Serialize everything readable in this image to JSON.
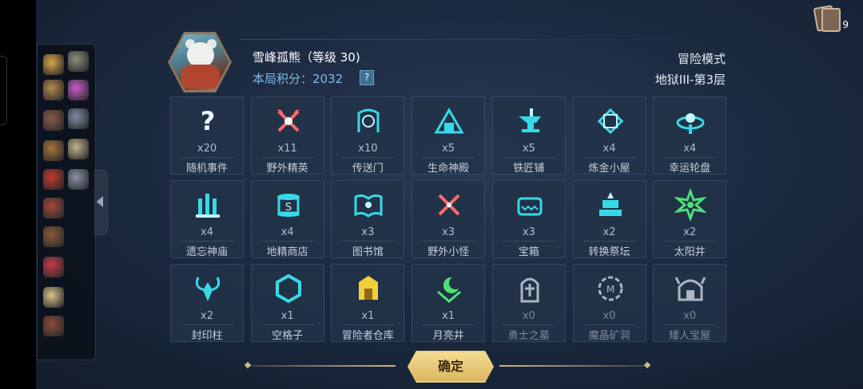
{
  "header": {
    "title": "雪峰孤熊（等级 30)",
    "score_label": "本局积分：",
    "score_value": "2032",
    "help_label": "?",
    "mode": "冒险模式",
    "level": "地狱III-第3层"
  },
  "deck": {
    "count": "9",
    "icon": "card-deck-icon"
  },
  "inventory": {
    "icons": [
      "gold-scroll-icon",
      "statue-icon",
      "chest-plus-icon",
      "planet-icon",
      "stone-icon",
      "card-icon",
      "slingshot-plus-icon",
      "map-plus-icon",
      "bomb-plus-icon",
      "knight-icon",
      "book-plus-icon",
      "tome-plus-icon",
      "claw-plus-icon",
      "scroll-plus-icon",
      "book-tome-icon"
    ]
  },
  "cells": [
    {
      "count": "x20",
      "label": "随机事件",
      "icon": "question-icon",
      "color": "#e9f6ff",
      "dim": false
    },
    {
      "count": "x11",
      "label": "野外精英",
      "icon": "crossed-axes-icon",
      "color": "#ff6a6a",
      "dim": false
    },
    {
      "count": "x10",
      "label": "传送门",
      "icon": "portal-icon",
      "color": "#37d9e8",
      "dim": false
    },
    {
      "count": "x5",
      "label": "生命神殿",
      "icon": "temple-icon",
      "color": "#37d9e8",
      "dim": false
    },
    {
      "count": "x5",
      "label": "铁匠铺",
      "icon": "anvil-icon",
      "color": "#37d9e8",
      "dim": false
    },
    {
      "count": "x4",
      "label": "炼金小屋",
      "icon": "alchemy-icon",
      "color": "#37d9e8",
      "dim": false
    },
    {
      "count": "x4",
      "label": "幸运轮盘",
      "icon": "wheel-icon",
      "color": "#37d9e8",
      "dim": false
    },
    {
      "count": "x4",
      "label": "遗忘神庙",
      "icon": "ruins-icon",
      "color": "#37d9e8",
      "dim": false
    },
    {
      "count": "x4",
      "label": "地精商店",
      "icon": "shop-icon",
      "color": "#37d9e8",
      "dim": false
    },
    {
      "count": "x3",
      "label": "图书馆",
      "icon": "book-icon",
      "color": "#37d9e8",
      "dim": false
    },
    {
      "count": "x3",
      "label": "野外小怪",
      "icon": "crossed-swords-icon",
      "color": "#ff6a6a",
      "dim": false
    },
    {
      "count": "x3",
      "label": "宝箱",
      "icon": "chest-icon",
      "color": "#37d9e8",
      "dim": false
    },
    {
      "count": "x2",
      "label": "转换祭坛",
      "icon": "altar-icon",
      "color": "#37d9e8",
      "dim": false
    },
    {
      "count": "x2",
      "label": "太阳井",
      "icon": "sun-icon",
      "color": "#4fe07a",
      "dim": false
    },
    {
      "count": "x2",
      "label": "封印柱",
      "icon": "seal-pillar-icon",
      "color": "#37d9e8",
      "dim": false
    },
    {
      "count": "x1",
      "label": "空格子",
      "icon": "hexagon-icon",
      "color": "#37d9e8",
      "dim": false
    },
    {
      "count": "x1",
      "label": "冒险者仓库",
      "icon": "warehouse-icon",
      "color": "#f2cf3b",
      "dim": false
    },
    {
      "count": "x1",
      "label": "月亮井",
      "icon": "moon-icon",
      "color": "#4fe07a",
      "dim": false
    },
    {
      "count": "x0",
      "label": "勇士之墓",
      "icon": "tomb-icon",
      "color": "#cfd6e0",
      "dim": true
    },
    {
      "count": "x0",
      "label": "魔晶矿洞",
      "icon": "crystal-mine-icon",
      "color": "#cfd6e0",
      "dim": true
    },
    {
      "count": "x0",
      "label": "矮人宝屋",
      "icon": "dwarf-house-icon",
      "color": "#cfd6e0",
      "dim": true
    }
  ],
  "confirm_label": "确定"
}
